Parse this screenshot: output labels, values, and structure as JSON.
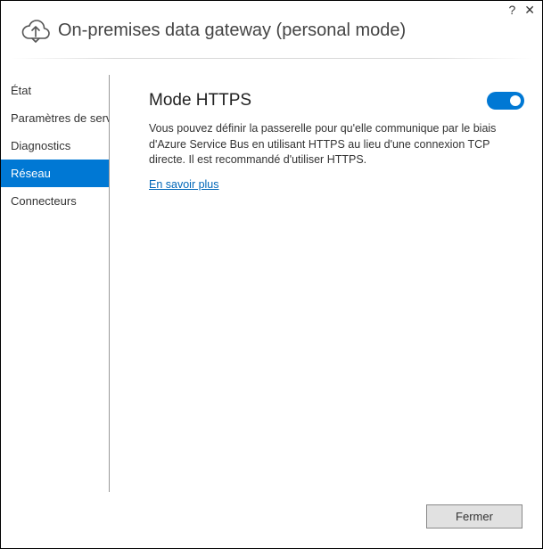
{
  "header": {
    "title": "On-premises data gateway (personal mode)"
  },
  "controls": {
    "help_symbol": "?",
    "close_symbol": "✕"
  },
  "sidebar": {
    "items": [
      {
        "label": "État",
        "selected": false
      },
      {
        "label": "Paramètres de service",
        "selected": false
      },
      {
        "label": "Diagnostics",
        "selected": false
      },
      {
        "label": "Réseau",
        "selected": true
      },
      {
        "label": "Connecteurs",
        "selected": false
      }
    ]
  },
  "main": {
    "https_mode": {
      "title": "Mode HTTPS",
      "toggle_on": true,
      "description": "Vous pouvez définir la passerelle pour qu'elle communique par le biais d'Azure Service Bus en utilisant HTTPS au lieu d'une connexion TCP directe. Il est recommandé d'utiliser HTTPS.",
      "learn_more": "En savoir plus"
    }
  },
  "footer": {
    "close_button": "Fermer"
  }
}
